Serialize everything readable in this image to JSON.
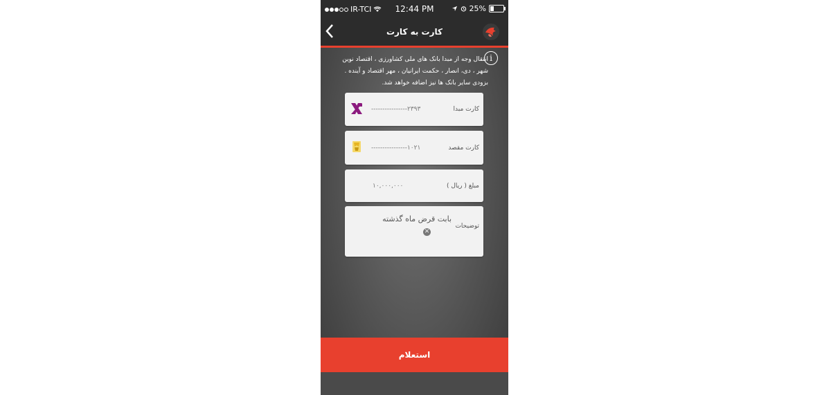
{
  "status_bar": {
    "carrier": "IR-TCI",
    "time": "12:44 PM",
    "battery": "25%",
    "battery_level": 0.25,
    "icons": [
      "signal-dots-icon",
      "wifi-icon",
      "location-arrow-icon",
      "alarm-icon",
      "battery-icon"
    ]
  },
  "nav": {
    "title": "کارت به کارت",
    "back_icon": "chevron-left-icon",
    "logo_icon": "app-logo-icon"
  },
  "info": {
    "text": "انتقال وجه از مبدا بانک های ملی کشاورزی ، اقتصاد نوین شهر ، دی، انصار ، حکمت ایرانیان ، مهر اقتصاد و آینده . بزودی سایر بانک ها نیز اضافه خواهد شد.",
    "icon": "info-icon"
  },
  "form": {
    "source_card": {
      "label": "کارت مبدا",
      "value": "----------------۲۳۹۳"
    },
    "dest_card": {
      "label": "کارت مقصد",
      "value": "----------------۱۰۲۱"
    },
    "amount": {
      "label": "مبلغ ( ریال )",
      "value": "۱۰,۰۰۰,۰۰۰"
    },
    "description": {
      "label": "توضیحات",
      "value": "بابت قرض ماه گذشته"
    }
  },
  "confirm_button": {
    "label": "استعلام"
  },
  "colors": {
    "accent": "#e8402e",
    "bar": "#2c2c2c",
    "card": "#f2f2f2",
    "source_bank": "#8b1a7e",
    "dest_bank": "#e6b422"
  }
}
